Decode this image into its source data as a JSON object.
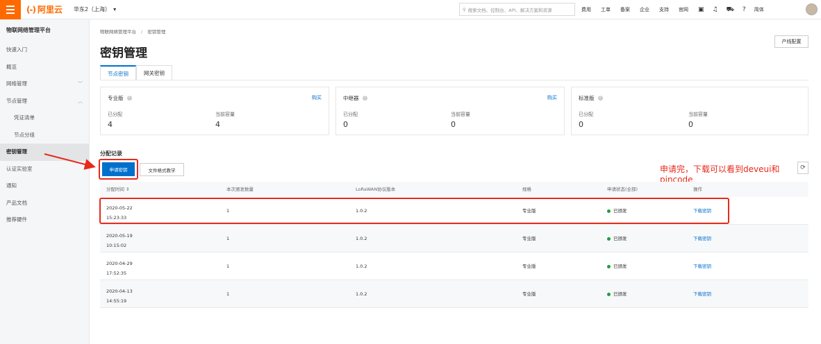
{
  "topbar": {
    "logo_text": "阿里云",
    "logo_mark": "(-)",
    "region": "华东2（上海）",
    "search_placeholder": "搜索文档、控制台、API、解决方案和资源",
    "nav": [
      "费用",
      "工单",
      "备案",
      "企业",
      "支持",
      "官网"
    ],
    "lang": "简体"
  },
  "sidebar": {
    "title": "物联网络管理平台",
    "items": [
      {
        "label": "快速入门"
      },
      {
        "label": "概览"
      },
      {
        "label": "网络管理",
        "caret": "﹀"
      },
      {
        "label": "节点管理",
        "caret": "︿"
      },
      {
        "label": "凭证清单"
      },
      {
        "label": "节点分组"
      },
      {
        "label": "密钥管理"
      },
      {
        "label": "认证实验室"
      },
      {
        "label": "通知"
      },
      {
        "label": "产品文档"
      },
      {
        "label": "推荐硬件"
      }
    ]
  },
  "breadcrumb": {
    "root": "物联网络管理平台",
    "sep": "/",
    "current": "密钥管理"
  },
  "page_title": "密钥管理",
  "config_button": "产线配置",
  "tabs": [
    "节点密钥",
    "网关密钥"
  ],
  "cards": [
    {
      "title": "专业版",
      "buy": "购买",
      "allocated_label": "已分配",
      "allocated": "4",
      "capacity_label": "当前容量",
      "capacity": "4"
    },
    {
      "title": "中继器",
      "buy": "购买",
      "allocated_label": "已分配",
      "allocated": "0",
      "capacity_label": "当前容量",
      "capacity": "0"
    },
    {
      "title": "标准版",
      "allocated_label": "已分配",
      "allocated": "0",
      "capacity_label": "当前容量",
      "capacity": "0"
    }
  ],
  "section_title": "分配记录",
  "apply_button": "申请密钥",
  "doc_button": "文件格式教学",
  "annotation": "申请完，下载可以看到deveui和pincode",
  "table": {
    "headers": [
      "分配时间 ⇕",
      "本次颁发数量",
      "LoRaWAN协议版本",
      "规格",
      "申请状态(全部)",
      "操作"
    ],
    "rows": [
      {
        "date": "2020-05-22",
        "time": "15:23:33",
        "count": "1",
        "version": "1.0.2",
        "spec": "专业版",
        "status": "已颁发",
        "action": "下载密钥"
      },
      {
        "date": "2020-05-19",
        "time": "10:15:02",
        "count": "1",
        "version": "1.0.2",
        "spec": "专业版",
        "status": "已颁发",
        "action": "下载密钥"
      },
      {
        "date": "2020-04-29",
        "time": "17:52:35",
        "count": "1",
        "version": "1.0.2",
        "spec": "专业版",
        "status": "已颁发",
        "action": "下载密钥"
      },
      {
        "date": "2020-04-13",
        "time": "14:55:19",
        "count": "1",
        "version": "1.0.2",
        "spec": "专业版",
        "status": "已颁发",
        "action": "下载密钥"
      }
    ]
  },
  "colors": {
    "brand": "#ff6a00",
    "primary": "#0070cc",
    "annotation": "#e8291c",
    "success": "#1e9e3a"
  }
}
